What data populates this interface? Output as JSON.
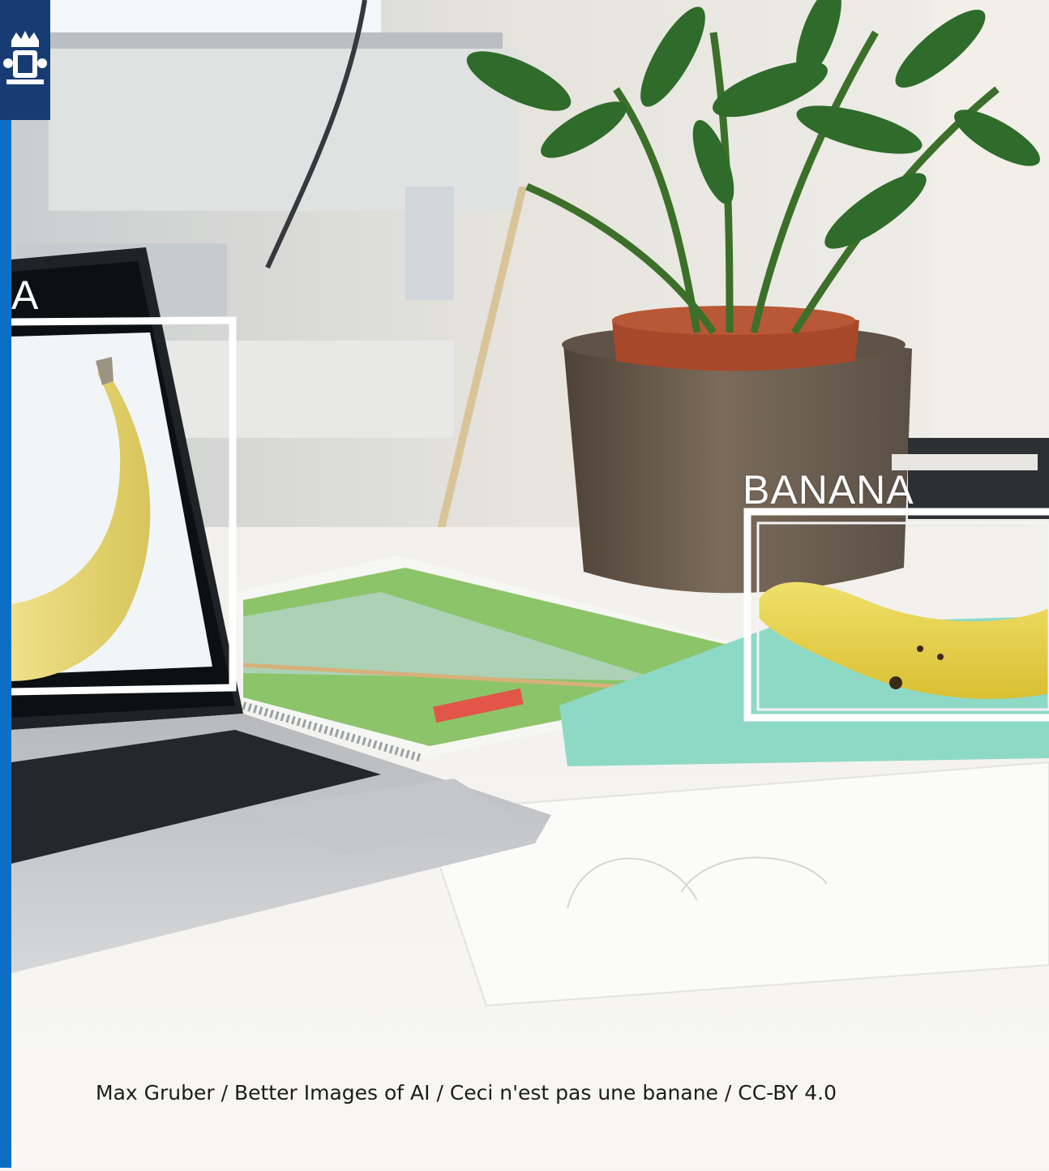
{
  "colors": {
    "accent_bar": "#0a6fc4",
    "logo_tile": "#173b73",
    "banana_yellow": "#ecd64a",
    "plant_green": "#2f6b2a",
    "pot_brown": "#6e5a47",
    "mat_teal": "#8ed9c6"
  },
  "logo": {
    "icon": "crown-lion-crest-icon"
  },
  "laptop_box_label": "A",
  "table_box_label": "BANANA",
  "credit": "Max Gruber / Better Images of AI / Ceci n'est pas une banane / CC-BY 4.0"
}
